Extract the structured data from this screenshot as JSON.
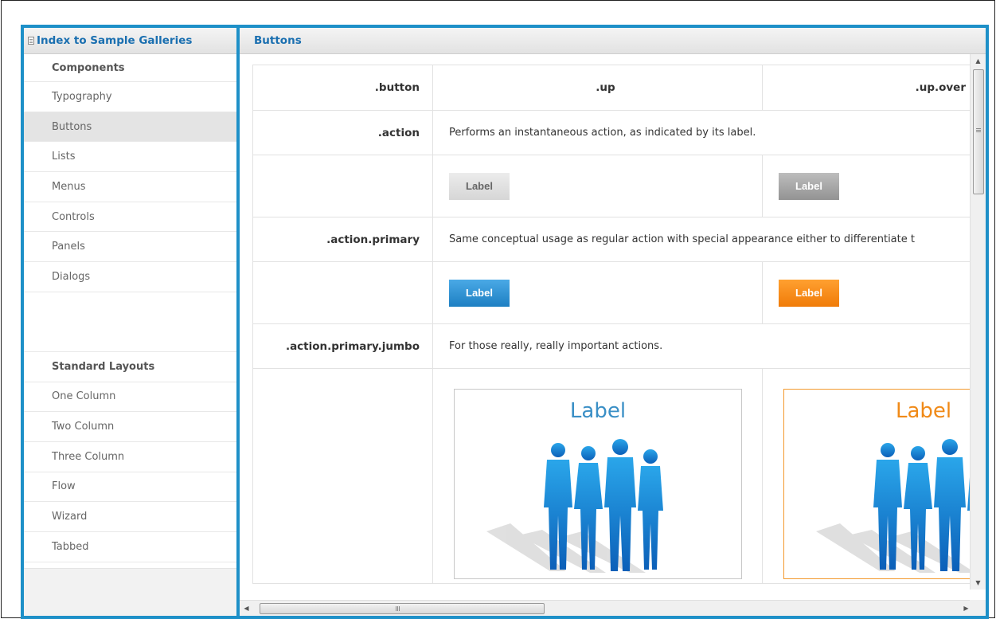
{
  "sidebar": {
    "title": "Index to Sample Galleries",
    "sections": [
      {
        "heading": "Components",
        "items": [
          "Typography",
          "Buttons",
          "Lists",
          "Menus",
          "Controls",
          "Panels",
          "Dialogs"
        ]
      },
      {
        "heading": "Standard Layouts",
        "items": [
          "One Column",
          "Two Column",
          "Three Column",
          "Flow",
          "Wizard",
          "Tabbed"
        ]
      }
    ],
    "selected": "Buttons"
  },
  "main": {
    "title": "Buttons",
    "columns": [
      ".button",
      ".up",
      ".up.over"
    ],
    "rows": {
      "action": {
        "class": ".action",
        "description": "Performs an instantaneous action, as indicated by its label.",
        "button_label": "Label"
      },
      "primary": {
        "class": ".action.primary",
        "description": "Same conceptual usage as regular action with special appearance either to differentiate t",
        "button_label": "Label"
      },
      "jumbo": {
        "class": ".action.primary.jumbo",
        "description": "For those really, really important actions.",
        "button_label": "Label"
      }
    }
  },
  "colors": {
    "frame_border": "#1e90c8",
    "title_text": "#1a6fb0",
    "primary_up": "#2b8fd6",
    "primary_over": "#f58a14",
    "figure_blue": "#1a8ad8"
  },
  "icons": {
    "scroll_up": "▲",
    "scroll_down": "▼",
    "scroll_left": "◀",
    "scroll_right": "▶",
    "grip": "Ш"
  }
}
